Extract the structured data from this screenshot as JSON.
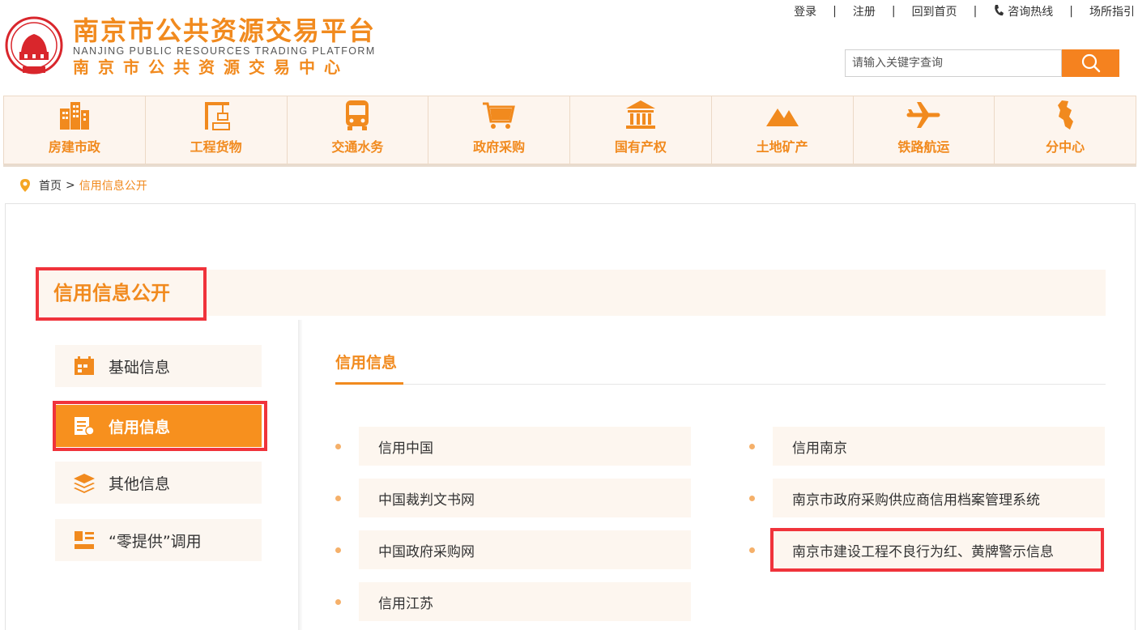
{
  "header": {
    "title_cn": "南京市公共资源交易平台",
    "title_en": "NANJING PUBLIC RESOURCES TRADING PLATFORM",
    "subtitle_cn": "南京市公共资源交易中心",
    "top_links": [
      "登录",
      "注册",
      "回到首页",
      "咨询热线",
      "场所指引"
    ],
    "search_placeholder": "请输入关键字查询"
  },
  "nav": {
    "items": [
      {
        "label": "房建市政",
        "icon": "building-icon"
      },
      {
        "label": "工程货物",
        "icon": "crane-icon"
      },
      {
        "label": "交通水务",
        "icon": "bus-icon"
      },
      {
        "label": "政府采购",
        "icon": "cart-icon"
      },
      {
        "label": "国有产权",
        "icon": "bank-icon"
      },
      {
        "label": "土地矿产",
        "icon": "mountain-icon"
      },
      {
        "label": "铁路航运",
        "icon": "plane-icon"
      },
      {
        "label": "分中心",
        "icon": "map-icon"
      }
    ]
  },
  "breadcrumb": {
    "home": "首页",
    "separator": ">",
    "current": "信用信息公开"
  },
  "page": {
    "title": "信用信息公开"
  },
  "sidebar": {
    "items": [
      {
        "label": "基础信息",
        "icon": "calendar-icon",
        "active": false
      },
      {
        "label": "信用信息",
        "icon": "certificate-icon",
        "active": true
      },
      {
        "label": "其他信息",
        "icon": "layers-icon",
        "active": false
      },
      {
        "label": "“零提供”调用",
        "icon": "document-icon",
        "active": false
      }
    ]
  },
  "content": {
    "title": "信用信息",
    "links_left": [
      "信用中国",
      "中国裁判文书网",
      "中国政府采购网",
      "信用江苏"
    ],
    "links_right": [
      "信用南京",
      "南京市政府采购供应商信用档案管理系统",
      "南京市建设工程不良行为红、黄牌警示信息"
    ]
  },
  "colors": {
    "accent": "#f18a1e",
    "button": "#f5821f",
    "highlight": "#f0333b",
    "panel_bg": "#fdf6ef"
  }
}
